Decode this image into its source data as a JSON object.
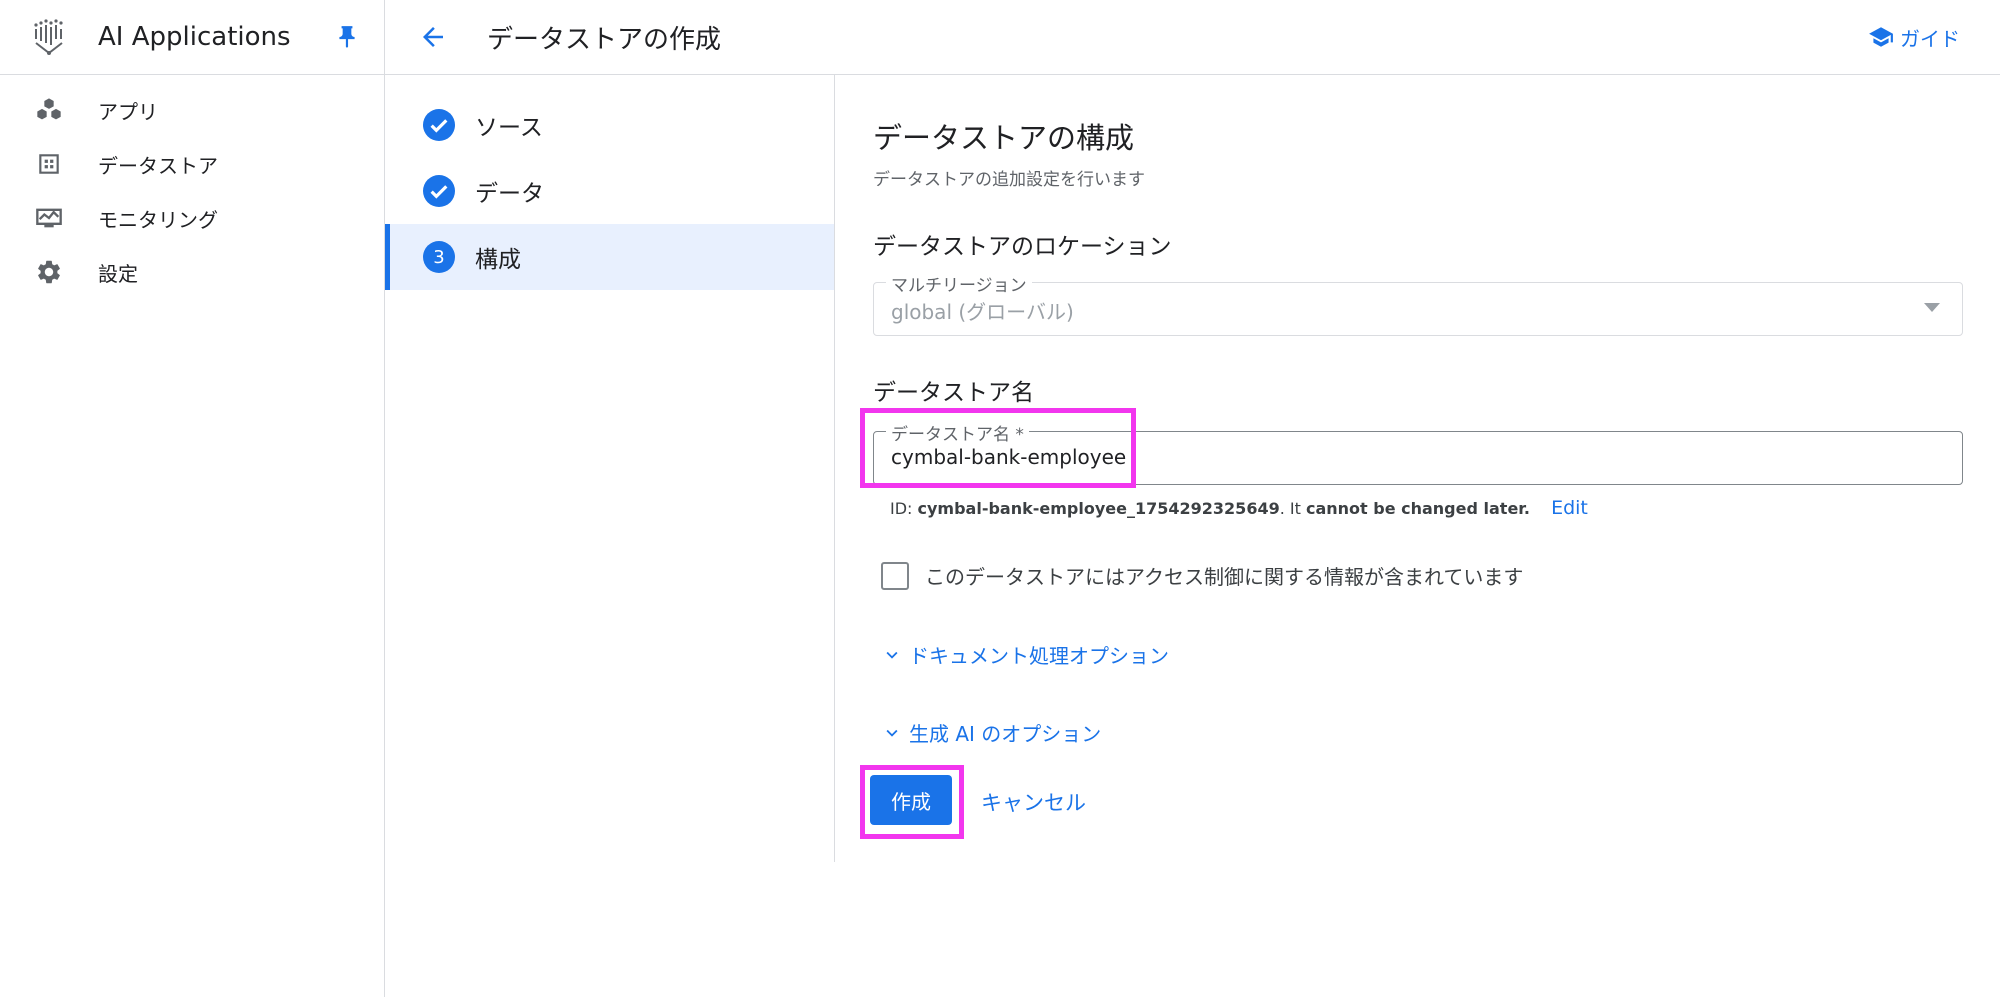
{
  "sidebar": {
    "app_title": "AI Applications",
    "items": [
      {
        "label": "アプリ",
        "icon": "apps-cubes-icon"
      },
      {
        "label": "データストア",
        "icon": "datastore-grid-icon"
      },
      {
        "label": "モニタリング",
        "icon": "monitoring-icon"
      },
      {
        "label": "設定",
        "icon": "gear-icon"
      }
    ]
  },
  "topbar": {
    "title": "データストアの作成",
    "guide_label": "ガイド"
  },
  "stepper": {
    "steps": [
      {
        "label": "ソース",
        "state": "done"
      },
      {
        "label": "データ",
        "state": "done"
      },
      {
        "label": "構成",
        "state": "active",
        "number": "3"
      }
    ]
  },
  "form": {
    "heading": "データストアの構成",
    "subtitle": "データストアの追加設定を行います",
    "location_heading": "データストアのロケーション",
    "region_label": "マルチリージョン",
    "region_value": "global (グローバル)",
    "name_heading": "データストア名",
    "name_label": "データストア名 *",
    "name_value": "cymbal-bank-employee",
    "id_prefix": "ID: ",
    "id_value": "cymbal-bank-employee_1754292325649",
    "id_middle": ". It ",
    "id_suffix": "cannot be changed later.",
    "edit_label": "Edit",
    "checkbox_label": "このデータストアにはアクセス制御に関する情報が含まれています",
    "doc_options": "ドキュメント処理オプション",
    "gen_options": "生成 AI のオプション",
    "create_label": "作成",
    "cancel_label": "キャンセル"
  },
  "colors": {
    "accent": "#1a73e8",
    "highlight": "#f236ee"
  }
}
